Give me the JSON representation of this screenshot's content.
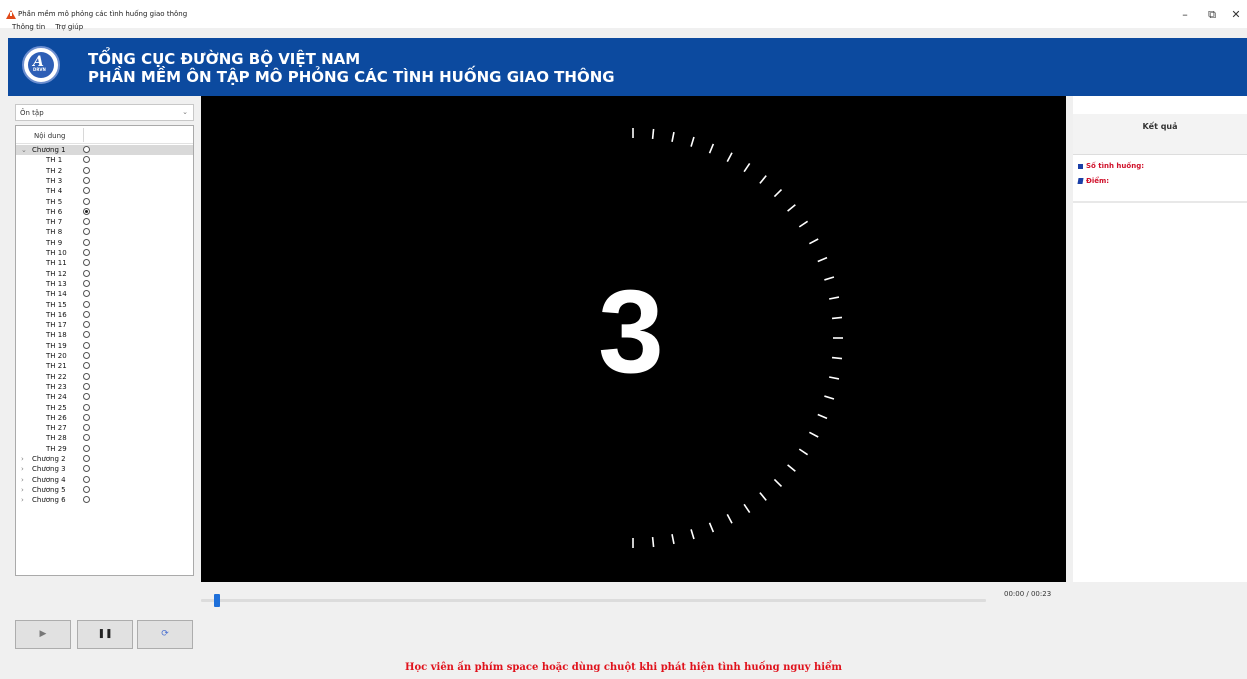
{
  "window": {
    "title": "Phần mềm mô phỏng các tình huống giao thông",
    "menu": [
      "Thông tin",
      "Trợ giúp"
    ],
    "controls": {
      "minimize": "–",
      "restore": "⧉",
      "close": "✕"
    }
  },
  "banner": {
    "logo_text": "DRVN",
    "title1": "TỔNG CỤC ĐƯỜNG BỘ VIỆT NAM",
    "title2": "PHẦN MỀM ÔN TẬP MÔ PHỎNG CÁC TÌNH HUỐNG GIAO THÔNG",
    "color": "#0c4a9f"
  },
  "mode_select": {
    "value": "Ôn tập"
  },
  "tree": {
    "header": "Nội dung",
    "chapters": [
      {
        "label": "Chương 1",
        "expanded": true,
        "selected": true,
        "items": [
          "TH 1",
          "TH 2",
          "TH 3",
          "TH 4",
          "TH 5",
          "TH 6",
          "TH 7",
          "TH 8",
          "TH 9",
          "TH 10",
          "TH 11",
          "TH 12",
          "TH 13",
          "TH 14",
          "TH 15",
          "TH 16",
          "TH 17",
          "TH 18",
          "TH 19",
          "TH 20",
          "TH 21",
          "TH 22",
          "TH 23",
          "TH 24",
          "TH 25",
          "TH 26",
          "TH 27",
          "TH 28",
          "TH 29"
        ],
        "checked_item": "TH 6"
      },
      {
        "label": "Chương 2",
        "expanded": false
      },
      {
        "label": "Chương 3",
        "expanded": false
      },
      {
        "label": "Chương 4",
        "expanded": false
      },
      {
        "label": "Chương 5",
        "expanded": false
      },
      {
        "label": "Chương 6",
        "expanded": false
      }
    ]
  },
  "video": {
    "countdown": "3"
  },
  "results": {
    "title": "Kết quả",
    "situations_label": "Số tình huống:",
    "score_label": "Điểm:"
  },
  "player": {
    "time": "00:00 / 00:23",
    "progress": 0.02,
    "play": "▶",
    "pause": "❚❚",
    "reload": "⟳"
  },
  "hint": "Học viên ấn phím space hoặc dùng chuột khi phát hiện tình huống nguy hiểm"
}
